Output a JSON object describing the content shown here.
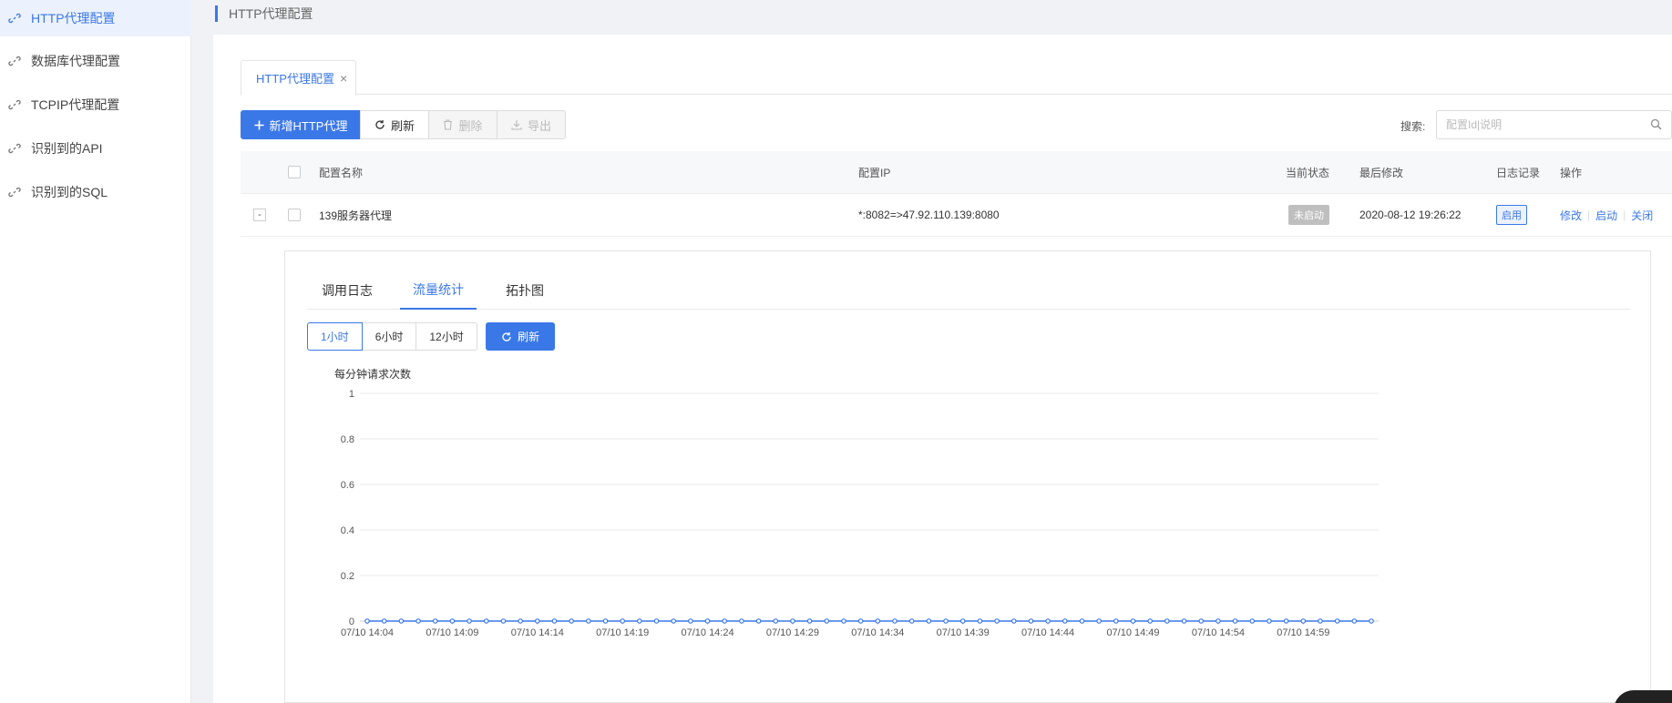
{
  "sidebar": {
    "items": [
      {
        "label": "HTTP代理配置",
        "icon": "link-icon",
        "active": true
      },
      {
        "label": "数据库代理配置",
        "icon": "link-icon",
        "active": false
      },
      {
        "label": "TCPIP代理配置",
        "icon": "link-icon",
        "active": false
      },
      {
        "label": "识别到的API",
        "icon": "link-icon",
        "active": false
      },
      {
        "label": "识别到的SQL",
        "icon": "link-icon",
        "active": false
      }
    ]
  },
  "breadcrumb": {
    "title": "HTTP代理配置"
  },
  "page_tab": {
    "label": "HTTP代理配置",
    "close": "×"
  },
  "toolbar": {
    "add_label": "新增HTTP代理",
    "refresh_label": "刷新",
    "delete_label": "删除",
    "export_label": "导出"
  },
  "search": {
    "label": "搜索:",
    "placeholder": "配置Id|说明"
  },
  "table": {
    "headers": {
      "name": "配置名称",
      "ip": "配置IP",
      "status": "当前状态",
      "modified": "最后修改",
      "log": "日志记录",
      "ops": "操作"
    },
    "rows": [
      {
        "expand": "-",
        "name": "139服务器代理",
        "ip": "*:8082=>47.92.110.139:8080",
        "status": "未启动",
        "modified": "2020-08-12 19:26:22",
        "log": "启用",
        "op_edit": "修改",
        "op_start": "启动",
        "op_close": "关闭"
      }
    ]
  },
  "detail": {
    "tabs": [
      {
        "label": "调用日志",
        "active": false
      },
      {
        "label": "流量统计",
        "active": true
      },
      {
        "label": "拓扑图",
        "active": false
      }
    ],
    "ranges": [
      {
        "label": "1小时",
        "active": true
      },
      {
        "label": "6小时",
        "active": false
      },
      {
        "label": "12小时",
        "active": false
      }
    ],
    "refresh_label": "刷新"
  },
  "colors": {
    "accent": "#3b78e7",
    "status_gray": "#bfbfbf"
  },
  "chart_data": {
    "type": "line",
    "title": "每分钟请求次数",
    "ylim": [
      0,
      1
    ],
    "yticks": [
      "0",
      "0.2",
      "0.4",
      "0.6",
      "0.8",
      "1"
    ],
    "xticklabels": [
      "07/10 14:04",
      "07/10 14:09",
      "07/10 14:14",
      "07/10 14:19",
      "07/10 14:24",
      "07/10 14:29",
      "07/10 14:34",
      "07/10 14:39",
      "07/10 14:44",
      "07/10 14:49",
      "07/10 14:54",
      "07/10 14:59"
    ],
    "x_start": "07/10 14:04",
    "x_end": "07/10 15:03",
    "values": [
      0,
      0,
      0,
      0,
      0,
      0,
      0,
      0,
      0,
      0,
      0,
      0,
      0,
      0,
      0,
      0,
      0,
      0,
      0,
      0,
      0,
      0,
      0,
      0,
      0,
      0,
      0,
      0,
      0,
      0,
      0,
      0,
      0,
      0,
      0,
      0,
      0,
      0,
      0,
      0,
      0,
      0,
      0,
      0,
      0,
      0,
      0,
      0,
      0,
      0,
      0,
      0,
      0,
      0,
      0,
      0,
      0,
      0,
      0,
      0
    ],
    "grid": true,
    "series_color": "#3b78e7"
  }
}
